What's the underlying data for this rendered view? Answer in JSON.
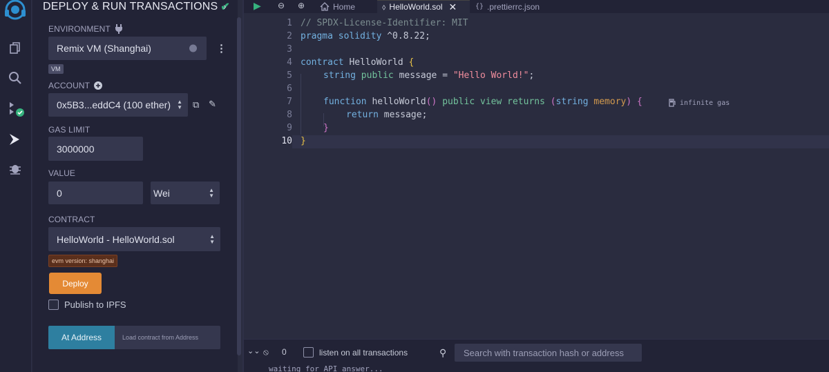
{
  "side_panel": {
    "title": "DEPLOY & RUN TRANSACTIONS",
    "environment": {
      "label": "ENVIRONMENT",
      "value": "Remix VM (Shanghai)",
      "badge": "VM"
    },
    "account": {
      "label": "ACCOUNT",
      "value": "0x5B3...eddC4 (100 ether)"
    },
    "gas_limit": {
      "label": "GAS LIMIT",
      "value": "3000000"
    },
    "value": {
      "label": "VALUE",
      "amount": "0",
      "unit": "Wei"
    },
    "contract": {
      "label": "CONTRACT",
      "value": "HelloWorld - HelloWorld.sol",
      "evm_badge": "evm version: shanghai"
    },
    "deploy_label": "Deploy",
    "publish_label": "Publish to IPFS",
    "at_address_label": "At Address",
    "load_contract_placeholder": "Load contract from Address"
  },
  "tabs": [
    {
      "label": "Home",
      "icon": "home-icon"
    },
    {
      "label": "HelloWorld.sol",
      "icon": "solidity-icon",
      "active": true
    },
    {
      "label": ".prettierrc.json",
      "icon": "json-braces-icon"
    }
  ],
  "editor": {
    "line_numbers": [
      "1",
      "2",
      "3",
      "4",
      "5",
      "6",
      "7",
      "8",
      "9",
      "10"
    ],
    "current_line": "10",
    "lines": {
      "l1": "// SPDX-License-Identifier: MIT",
      "l2_kw": "pragma solidity",
      "l2_rest": " ^0.8.22;",
      "l4_kw": "contract",
      "l4_name": " HelloWorld ",
      "l4_brace": "{",
      "l5_type": "string",
      "l5_vis": " public",
      "l5_name": " message = ",
      "l5_str": "\"Hello World!\"",
      "l5_end": ";",
      "l7_kw": "function",
      "l7_name": " helloWorld",
      "l7_paren": "()",
      "l7_pub": " public",
      "l7_view": " view",
      "l7_ret": " returns",
      "l7_open": " (",
      "l7_type": "string",
      "l7_mem": " memory",
      "l7_close": ")",
      "l7_brace": " {",
      "l8_kw": "return",
      "l8_rest": " message;",
      "l9": "}",
      "l10": "}"
    },
    "gas_hint": "infinite gas"
  },
  "terminal": {
    "count": "0",
    "listen_label": "listen on all transactions",
    "search_placeholder": "Search with transaction hash or address",
    "output": "waiting for API answer..."
  },
  "colors": {
    "deploy": "#e48a35",
    "at_address": "#2e7fa0",
    "success": "#36b37e"
  }
}
